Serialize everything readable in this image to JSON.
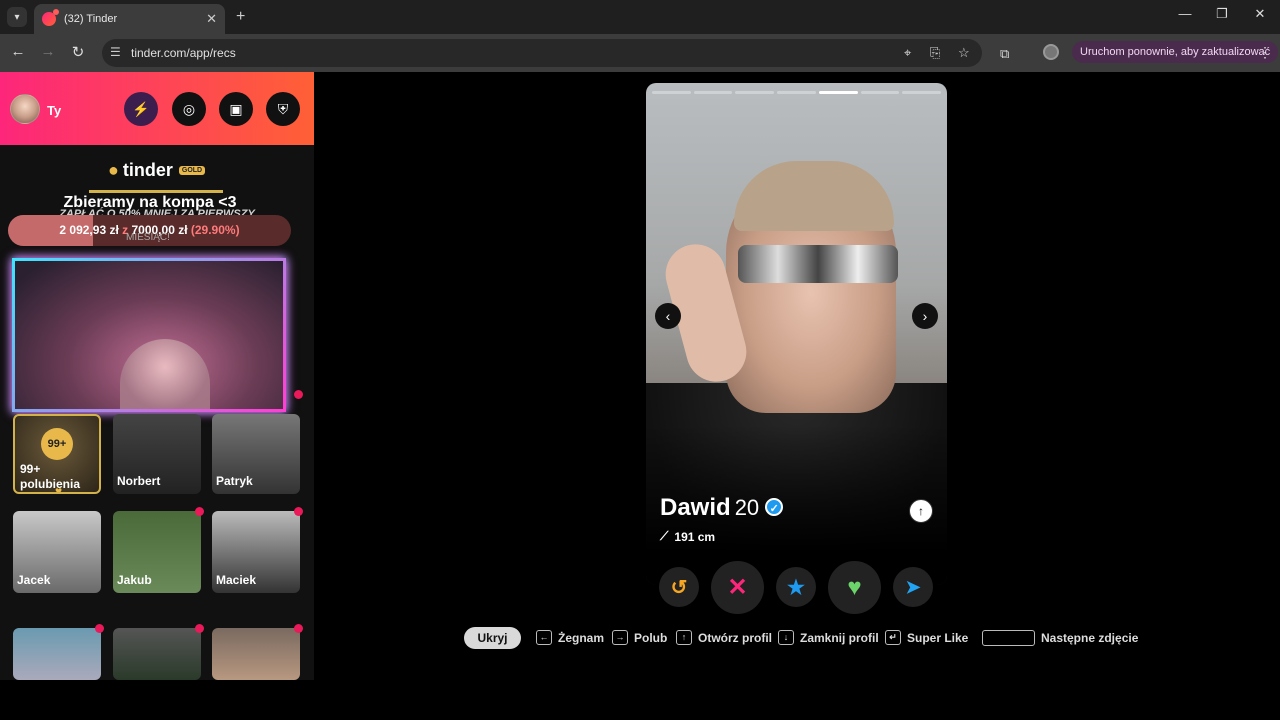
{
  "browser": {
    "tab_title": "(32) Tinder",
    "url": "tinder.com/app/recs",
    "update_button": "Uruchom ponownie, aby zaktualizować",
    "new_tab_glyph": "+",
    "close_glyph": "✕"
  },
  "sidebar": {
    "user_label": "Ty",
    "logo_text": "tinder",
    "gold_badge": "GOLD",
    "goal": {
      "title": "Zbieramy na kompa <3",
      "subtitle": "ZAPŁAĆ O 50% MNIEJ ZA PIERWSZY",
      "current": "2 092,93 zł",
      "of": "z",
      "target": "7000,00 zł",
      "percent": "(29.90%)",
      "progress_fraction": 0.299,
      "monthly": "MIESIĄC!"
    },
    "likes": {
      "badge": "99+",
      "label": "99+ polubienia"
    },
    "matches": [
      {
        "name": "Norbert"
      },
      {
        "name": "Patryk"
      },
      {
        "name": "Jacek"
      },
      {
        "name": "Jakub"
      },
      {
        "name": "Maciek"
      },
      {
        "name": ""
      },
      {
        "name": ""
      },
      {
        "name": ""
      }
    ]
  },
  "card": {
    "name": "Dawid",
    "age": "20",
    "height": "191 cm",
    "photo_count": 7,
    "active_photo": 5
  },
  "shortcuts": {
    "hide": "Ukryj",
    "nope": "Żegnam",
    "like": "Polub",
    "open_profile": "Otwórz profil",
    "close_profile": "Zamknij profil",
    "super_like": "Super Like",
    "next_photo": "Następne zdjęcie"
  },
  "colors": {
    "brand_gradient_start": "#fd267a",
    "brand_gradient_end": "#ff6036",
    "gold": "#e9b84a",
    "nope": "#fd267a",
    "super_like": "#1e9bf0",
    "like": "#6bd46b",
    "rewind": "#f5a623",
    "boost": "#20a4f3"
  }
}
